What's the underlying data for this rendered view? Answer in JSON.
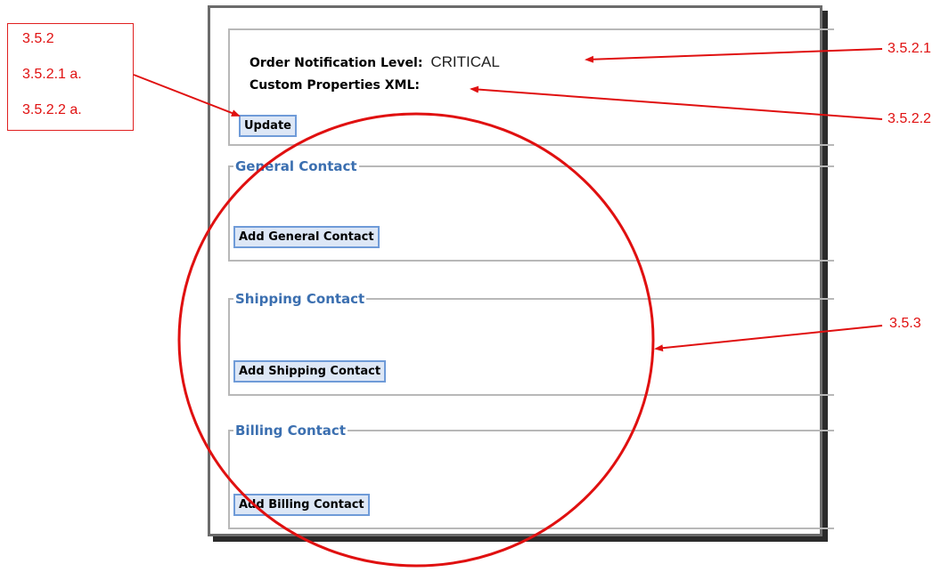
{
  "notification": {
    "level_label": "Order Notification Level:",
    "level_value": "CRITICAL",
    "xml_label": "Custom Properties XML:",
    "update_button": "Update"
  },
  "contacts": {
    "general": {
      "legend": "General Contact",
      "button": "Add General Contact"
    },
    "shipping": {
      "legend": "Shipping Contact",
      "button": "Add Shipping Contact"
    },
    "billing": {
      "legend": "Billing Contact",
      "button": "Add Billing Contact"
    }
  },
  "annotations": {
    "box_lines": [
      "3.5.2",
      "3.5.2.1 a.",
      "3.5.2.2 a."
    ],
    "ref_level": "3.5.2.1",
    "ref_xml": "3.5.2.2",
    "ref_contacts": "3.5.3",
    "color": "#e01010"
  }
}
